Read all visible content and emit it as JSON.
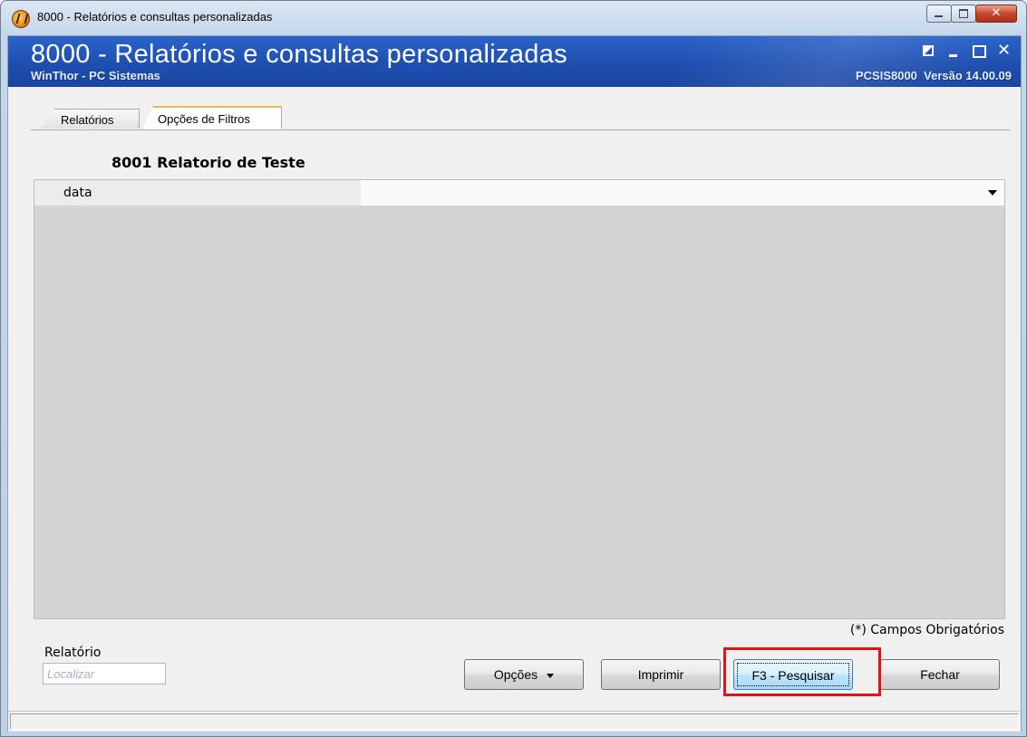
{
  "window": {
    "title": "8000 - Relatórios e consultas personalizadas"
  },
  "banner": {
    "title": "8000 - Relatórios e consultas personalizadas",
    "subtitle": "WinThor - PC Sistemas",
    "code_version": "PCSIS8000  Versão 14.00.09"
  },
  "tabs": [
    {
      "label": "Relatórios",
      "active": false
    },
    {
      "label": "Opções de Filtros",
      "active": true
    }
  ],
  "report": {
    "title": "8001 Relatorio de Teste"
  },
  "filters": [
    {
      "label": "data",
      "value": ""
    }
  ],
  "required_note": "(*) Campos Obrigatórios",
  "search": {
    "label": "Relatório",
    "placeholder": "Localizar"
  },
  "buttons": {
    "opcoes": "Opções",
    "imprimir": "Imprimir",
    "pesquisar": "F3 - Pesquisar",
    "fechar": "Fechar"
  },
  "highlight_color": "#e0131b",
  "colors": {
    "banner": "#1e4fb0",
    "grid_background": "#d4d4d4"
  }
}
